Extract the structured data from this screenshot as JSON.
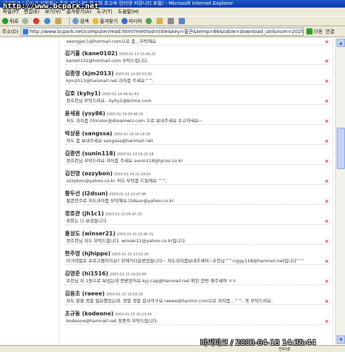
{
  "window": {
    "title": "비씨파크 | 글쓰기 지원하는 주요 커뮤니티 최고의 초고속 인터넷 커뮤니티 포털! - Microsoft Internet Explorer"
  },
  "watermarks": {
    "top": "http://www.bcpark.net",
    "bottom": "비씨파크 / 2003-04-18 14:35:44"
  },
  "menu": [
    "파일(F)",
    "편집(E)",
    "보기(V)",
    "즐겨찾기(A)",
    "도구(T)",
    "도움말(H)"
  ],
  "toolbar": {
    "back": "뒤로",
    "search": "검색",
    "favorites": "즐겨찾기",
    "media": "미디어"
  },
  "address": {
    "label": "주소(D)",
    "url": "http://www.bcpark.net/computer/read.html?method=title&key=팔콘&temp=66&table=download_util&num=2029&no=2699&page=1",
    "go": "이동",
    "links": "연결"
  },
  "comments": [
    {
      "name": "",
      "date": "",
      "text": "seongjec1@hotmail.com으로 좀...부탁해요"
    },
    {
      "name": "김기홀 (kane0102)",
      "date": "2003-01-13 23:06:25",
      "text": "kane0102@hotmail.com 부탁드립니다."
    },
    {
      "name": "김종영 (kjm2013)",
      "date": "2003-01-14 03:53:30",
      "text": "kjm2013@hanmail.net 과자좀 주세요^^;"
    },
    {
      "name": "김호 (kyhy1)",
      "date": "2003-01-14 09:42:43",
      "text": "정호천님 부탁드려요...kyhy1@bcline.com"
    },
    {
      "name": "윤세용 (ysy86)",
      "date": "2003-01-14 09:46:25",
      "text": "저도 과자좀 05icolor@dreamwiz.com 으로 보내주세요 수고하세요~"
    },
    {
      "name": "박상윤 (sangssa)",
      "date": "2003-01-14 16:14:36",
      "text": "저도 좀 보내주세요 sangssa@hanmail.net"
    },
    {
      "name": "김종연 (sunin118)",
      "date": "2003-01-14 19:25:18",
      "text": "정호천님 부탁드려요 과자좀 주세요 sunin118@lycos.co.kr"
    },
    {
      "name": "김진영 (ozzybon)",
      "date": "2003-01-14 22:24:03",
      "text": "ozzybon@yahoo.co.kr 저도 부탁좀 드릴께요 ^^;"
    },
    {
      "name": "황두선 (l2dsun)",
      "date": "2003-01-14 22:47:48",
      "text": "팔콘안주로 저도과자좀 부탁해요 l2dsun@yahoo.co.kr"
    },
    {
      "name": "정호관 (jh1c1)",
      "date": "2003-01-15 05:47:23",
      "text": "위용는 다 보냈습니다."
    },
    {
      "name": "홍성도 (winser21)",
      "date": "2003-01-15 10:46:31",
      "text": "정호천님 저도 부탁드립니다. winser21@yahoo.co.kr입니다."
    },
    {
      "name": "한주영 (hjhippo)",
      "date": "2003-01-15 13:52:29",
      "text": "이거야말로 프로그램이지요? 위에거다운받었습니다~ 저도과자좀보내주세여~호천님^^ciggy118@hanmail.net입니다^^"
    },
    {
      "name": "김영준 (hi1516)",
      "date": "2003-01-15 14:02:46",
      "text": "호천님 저 1등으로 보냈는데 못받았어요 kyj-cap@hanmail.net 확인 한번 해주세여 ㅠㅠ"
    },
    {
      "name": "김용조 (raeee)",
      "date": "2003-01-15 15:03:28",
      "text": "저도 잘을 정말 필요했었는데..정말 정말 감사하구요 raeee@hanmir.com으로 과자좀...^^; 꼭 부탁드려요.."
    },
    {
      "name": "조규동 (kodeone)",
      "date": "2003-01-15 20:23:34",
      "text": "kodeone@hanmail.net 정중히 부탁드립니다."
    }
  ],
  "delete_glyph": "×",
  "status": {
    "zone": "인터넷"
  }
}
